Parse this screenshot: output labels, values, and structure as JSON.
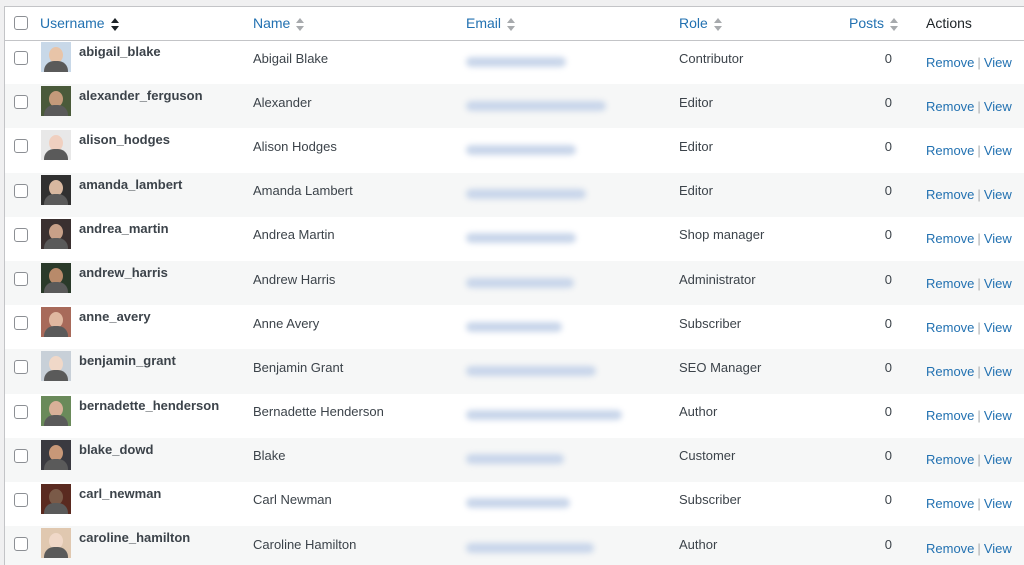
{
  "columns": {
    "username": "Username",
    "name": "Name",
    "email": "Email",
    "role": "Role",
    "posts": "Posts",
    "actions": "Actions"
  },
  "actions": {
    "remove": "Remove",
    "view": "View",
    "separator": "|"
  },
  "colors": {
    "link": "#2271b1",
    "row_alt": "#f6f7f7",
    "border": "#c3c4c7"
  },
  "users": [
    {
      "username": "abigail_blake",
      "name": "Abigail Blake",
      "role": "Contributor",
      "posts": "0"
    },
    {
      "username": "alexander_ferguson",
      "name": "Alexander",
      "role": "Editor",
      "posts": "0"
    },
    {
      "username": "alison_hodges",
      "name": "Alison Hodges",
      "role": "Editor",
      "posts": "0"
    },
    {
      "username": "amanda_lambert",
      "name": "Amanda Lambert",
      "role": "Editor",
      "posts": "0"
    },
    {
      "username": "andrea_martin",
      "name": "Andrea Martin",
      "role": "Shop manager",
      "posts": "0"
    },
    {
      "username": "andrew_harris",
      "name": "Andrew Harris",
      "role": "Administrator",
      "posts": "0"
    },
    {
      "username": "anne_avery",
      "name": "Anne Avery",
      "role": "Subscriber",
      "posts": "0"
    },
    {
      "username": "benjamin_grant",
      "name": "Benjamin Grant",
      "role": "SEO Manager",
      "posts": "0"
    },
    {
      "username": "bernadette_henderson",
      "name": "Bernadette Henderson",
      "role": "Author",
      "posts": "0"
    },
    {
      "username": "blake_dowd",
      "name": "Blake",
      "role": "Customer",
      "posts": "0"
    },
    {
      "username": "carl_newman",
      "name": "Carl Newman",
      "role": "Subscriber",
      "posts": "0"
    },
    {
      "username": "caroline_hamilton",
      "name": "Caroline Hamilton",
      "role": "Author",
      "posts": "0"
    }
  ]
}
